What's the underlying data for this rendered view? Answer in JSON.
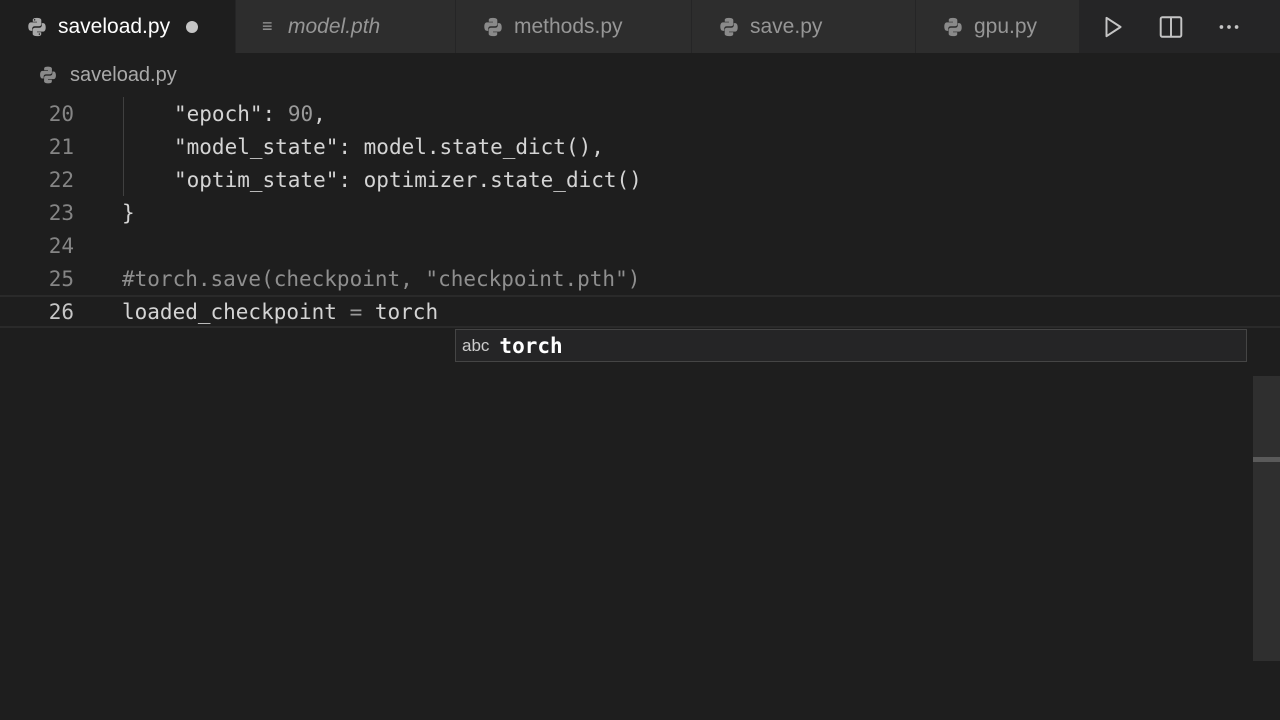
{
  "tabs": [
    {
      "label": "saveload.py",
      "icon": "python-icon",
      "active": true,
      "dirty": true
    },
    {
      "label": "model.pth",
      "icon": "lines-icon",
      "active": false,
      "italic": true
    },
    {
      "label": "methods.py",
      "icon": "python-icon",
      "active": false
    },
    {
      "label": "save.py",
      "icon": "python-icon",
      "active": false
    },
    {
      "label": "gpu.py",
      "icon": "python-icon",
      "active": false
    }
  ],
  "actions": [
    "run-icon",
    "split-editor-icon",
    "more-icon"
  ],
  "breadcrumb": {
    "file": "saveload.py"
  },
  "editor": {
    "lines": [
      {
        "number": "20"
      },
      {
        "number": "21"
      },
      {
        "number": "22"
      },
      {
        "number": "23"
      },
      {
        "number": "24"
      },
      {
        "number": "25"
      },
      {
        "number": "26"
      }
    ],
    "code": {
      "l20_key": "\"epoch\"",
      "l20_colon": ": ",
      "l20_value": "90",
      "l20_comma": ",",
      "l21_key": "\"model_state\"",
      "l21_rest": ": model.state_dict(),",
      "l22_key": "\"optim_state\"",
      "l22_rest": ": optimizer.state_dict()",
      "l23": "}",
      "l25": "#torch.save(checkpoint, \"checkpoint.pth\")",
      "l26_var": "loaded_checkpoint",
      "l26_eq": " = ",
      "l26_val": "torch"
    }
  },
  "suggestion": {
    "kind": "abc",
    "word": "torch"
  },
  "colors": {
    "background": "#1e1e1e",
    "tabbar": "#252526",
    "suggest_bg": "#252526"
  }
}
